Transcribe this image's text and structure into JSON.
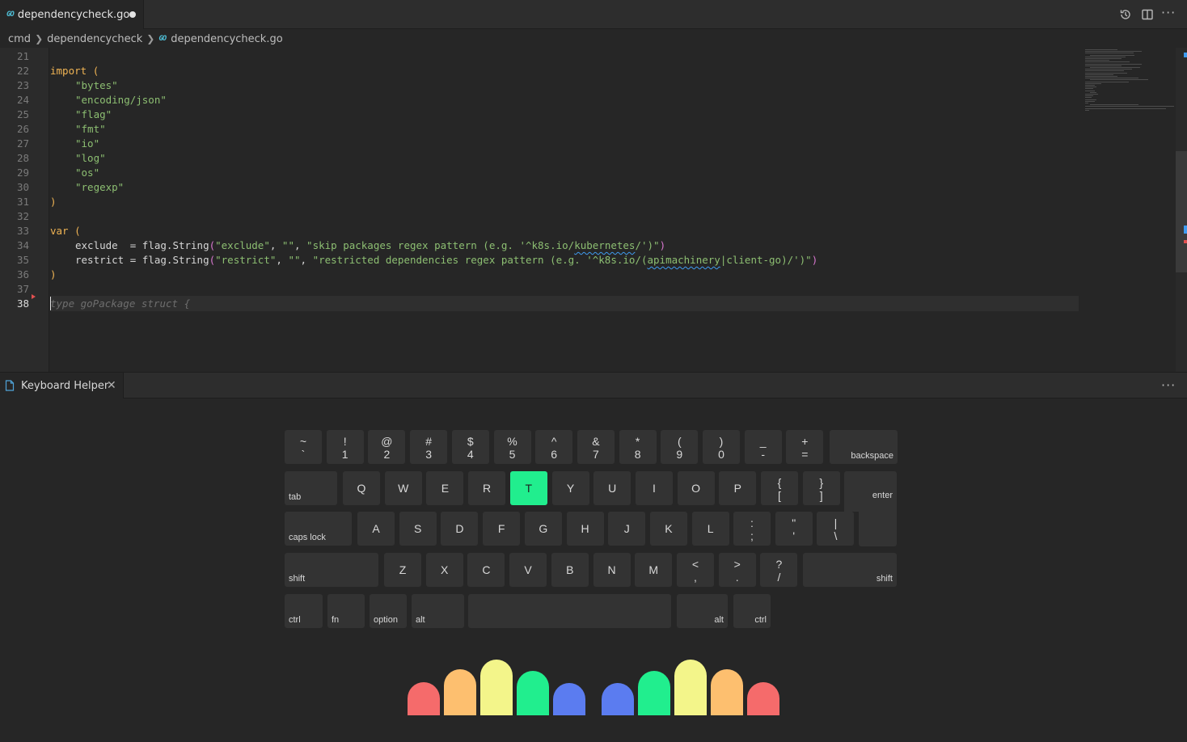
{
  "tab": {
    "filename": "dependencycheck.go",
    "dirty": true
  },
  "breadcrumb": [
    "cmd",
    "dependencycheck",
    "dependencycheck.go"
  ],
  "editor": {
    "line_numbers": [
      "21",
      "22",
      "23",
      "24",
      "25",
      "26",
      "27",
      "28",
      "29",
      "30",
      "31",
      "32",
      "33",
      "34",
      "35",
      "36",
      "37",
      "38"
    ],
    "lines": {
      "l22_kw": "import",
      "l22_paren": "(",
      "l23": "\"bytes\"",
      "l24": "\"encoding/json\"",
      "l25": "\"flag\"",
      "l26": "\"fmt\"",
      "l27": "\"io\"",
      "l28": "\"log\"",
      "l29": "\"os\"",
      "l30": "\"regexp\"",
      "l31": ")",
      "l33_kw": "var",
      "l33_paren": "(",
      "l34_name": "exclude",
      "l34_pad": "  = ",
      "l34_pkg": "flag",
      "l34_fn": "String",
      "l34_a1": "\"exclude\"",
      "l34_a2": "\"\"",
      "l34_a3a": "\"skip packages regex pattern (e.g. '^k8s.io/",
      "l34_a3sq": "kubernetes",
      "l34_a3b": "/')\"",
      "l35_name": "restrict",
      "l35_pad": " = ",
      "l35_pkg": "flag",
      "l35_fn": "String",
      "l35_a1": "\"restrict\"",
      "l35_a2": "\"\"",
      "l35_a3a": "\"restricted dependencies regex pattern (e.g. '^k8s.io/(",
      "l35_a3sq": "apimachinery",
      "l35_a3b": "|client-go)/')\"",
      "l36": ")",
      "l38_ghost": "type goPackage struct {"
    }
  },
  "panel": {
    "title": "Keyboard Helper"
  },
  "keyboard": {
    "row1": [
      {
        "top": "~",
        "bot": "`"
      },
      {
        "top": "!",
        "bot": "1"
      },
      {
        "top": "@",
        "bot": "2"
      },
      {
        "top": "#",
        "bot": "3"
      },
      {
        "top": "$",
        "bot": "4"
      },
      {
        "top": "%",
        "bot": "5"
      },
      {
        "top": "^",
        "bot": "6"
      },
      {
        "top": "&",
        "bot": "7"
      },
      {
        "top": "*",
        "bot": "8"
      },
      {
        "top": "(",
        "bot": "9"
      },
      {
        "top": ")",
        "bot": "0"
      },
      {
        "top": "_",
        "bot": "-"
      },
      {
        "top": "+",
        "bot": "="
      }
    ],
    "backspace": "backspace",
    "tab": "tab",
    "row2": [
      "Q",
      "W",
      "E",
      "R",
      "T",
      "Y",
      "U",
      "I",
      "O",
      "P"
    ],
    "row2_sym": [
      {
        "top": "{",
        "bot": "["
      },
      {
        "top": "}",
        "bot": "]"
      }
    ],
    "enter": "enter",
    "caps": "caps lock",
    "row3": [
      "A",
      "S",
      "D",
      "F",
      "G",
      "H",
      "J",
      "K",
      "L"
    ],
    "row3_sym": [
      {
        "top": ":",
        "bot": ";"
      },
      {
        "top": "\"",
        "bot": "'"
      },
      {
        "top": "|",
        "bot": "\\"
      }
    ],
    "shift_l": "shift",
    "row4": [
      "Z",
      "X",
      "C",
      "V",
      "B",
      "N",
      "M"
    ],
    "row4_sym": [
      {
        "top": "<",
        "bot": ","
      },
      {
        "top": ">",
        "bot": "."
      },
      {
        "top": "?",
        "bot": "/"
      }
    ],
    "shift_r": "shift",
    "ctrl_l": "ctrl",
    "fn": "fn",
    "option": "option",
    "alt_l": "alt",
    "alt_r": "alt",
    "ctrl_r": "ctrl",
    "highlighted_key": "T",
    "highlight_color": "#21ee8e"
  },
  "fingers": {
    "colors": [
      "#f56b6b",
      "#fdbf6f",
      "#f3f58a",
      "#21ee8e",
      "#5b7cf0"
    ]
  }
}
